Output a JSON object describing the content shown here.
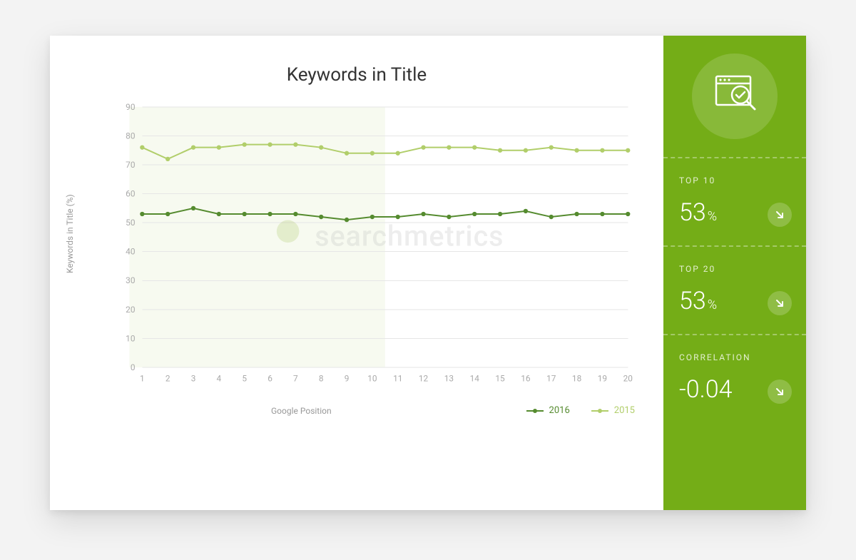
{
  "chart_data": {
    "type": "line",
    "title": "Keywords in Title",
    "xlabel": "Google Position",
    "ylabel": "Keywords in Title (%)",
    "ylim": [
      0,
      90
    ],
    "x": [
      1,
      2,
      3,
      4,
      5,
      6,
      7,
      8,
      9,
      10,
      11,
      12,
      13,
      14,
      15,
      16,
      17,
      18,
      19,
      20
    ],
    "series": [
      {
        "name": "2016",
        "values": [
          53,
          53,
          55,
          53,
          53,
          53,
          53,
          52,
          51,
          52,
          52,
          53,
          52,
          53,
          53,
          54,
          52,
          53,
          53,
          53
        ]
      },
      {
        "name": "2015",
        "values": [
          76,
          72,
          76,
          76,
          77,
          77,
          77,
          76,
          74,
          74,
          74,
          76,
          76,
          76,
          75,
          75,
          76,
          75,
          75,
          75
        ]
      }
    ],
    "watermark": "searchmetrics"
  },
  "sidebar": {
    "top10": {
      "label": "TOP 10",
      "value": "53",
      "suffix": "%",
      "trend": "down"
    },
    "top20": {
      "label": "TOP 20",
      "value": "53",
      "suffix": "%",
      "trend": "down"
    },
    "correlation": {
      "label": "CORRELATION",
      "value": "-0.04",
      "suffix": "",
      "trend": "down"
    }
  }
}
